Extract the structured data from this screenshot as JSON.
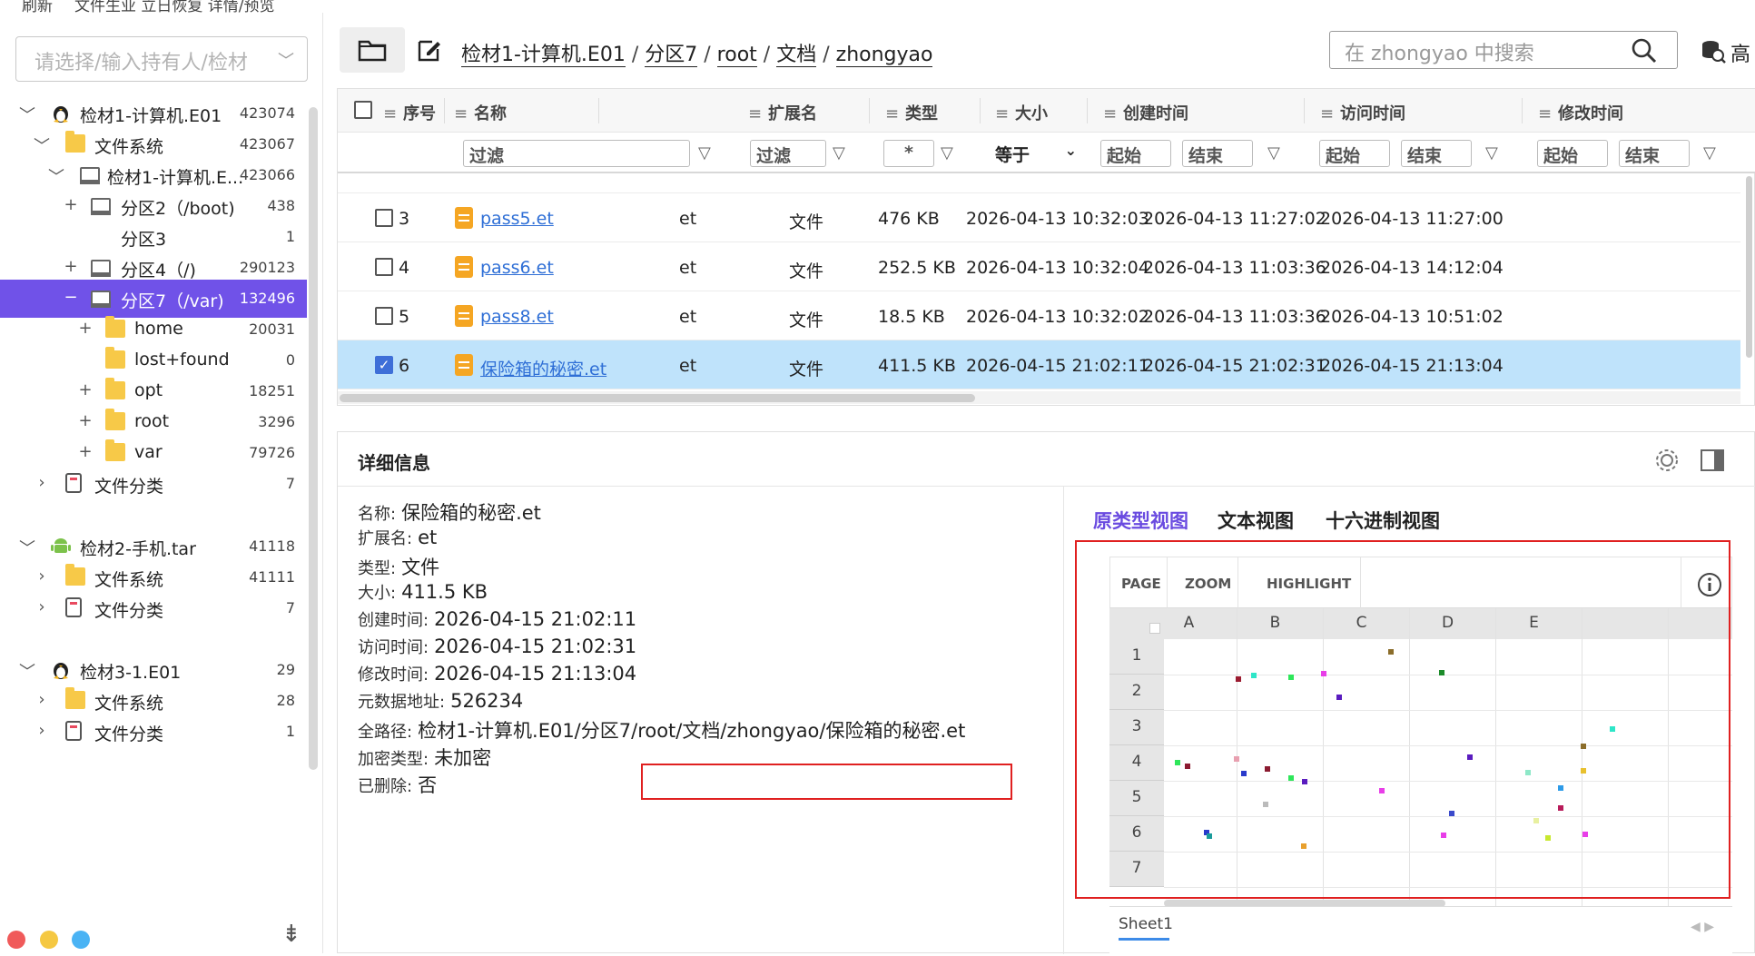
{
  "top": {
    "left_text": "刷新",
    "right_text": "文件生业 立日恢复 详情/预览"
  },
  "owner_select": {
    "placeholder": "请选择/输入持有人/检材"
  },
  "tree": [
    {
      "label": "检材1-计算机.E01",
      "count": "423074"
    },
    {
      "label": "文件系统",
      "count": "423067"
    },
    {
      "label": "检材1-计算机.E...",
      "count": "423066"
    },
    {
      "label": "分区2（/boot)",
      "count": "438"
    },
    {
      "label": "分区3",
      "count": "1"
    },
    {
      "label": "分区4（/)",
      "count": "290123"
    },
    {
      "label": "分区7（/var)",
      "count": "132496"
    },
    {
      "label": "home",
      "count": "20031"
    },
    {
      "label": "lost+found",
      "count": "0"
    },
    {
      "label": "opt",
      "count": "18251"
    },
    {
      "label": "root",
      "count": "3296"
    },
    {
      "label": "var",
      "count": "79726"
    },
    {
      "label": "文件分类",
      "count": "7"
    },
    {
      "label": "检材2-手机.tar",
      "count": "41118"
    },
    {
      "label": "文件系统",
      "count": "41111"
    },
    {
      "label": "文件分类",
      "count": "7"
    },
    {
      "label": "检材3-1.E01",
      "count": "29"
    },
    {
      "label": "文件系统",
      "count": "28"
    },
    {
      "label": "文件分类",
      "count": "1"
    }
  ],
  "breadcrumb": [
    "检材1-计算机.E01",
    "分区7",
    "root",
    "文档",
    "zhongyao"
  ],
  "search": {
    "placeholder": "在 zhongyao 中搜索"
  },
  "advanced_label": "高",
  "grid": {
    "headers": [
      "序号",
      "名称",
      "扩展名",
      "类型",
      "大小",
      "创建时间",
      "访问时间",
      "修改时间"
    ],
    "filters": {
      "text": "过滤",
      "ext": "过滤",
      "type": "*",
      "size": "等于",
      "start": "起始",
      "end": "结束"
    },
    "rows": [
      {
        "no": "3",
        "name": "pass5.et",
        "ext": "et",
        "type": "文件",
        "size": "476 KB",
        "created": "2026-04-13 10:32:03",
        "accessed": "2026-04-13 11:27:02",
        "modified": "2026-04-13 11:27:00"
      },
      {
        "no": "4",
        "name": "pass6.et",
        "ext": "et",
        "type": "文件",
        "size": "252.5 KB",
        "created": "2026-04-13 10:32:04",
        "accessed": "2026-04-13 11:03:36",
        "modified": "2026-04-13 14:12:04"
      },
      {
        "no": "5",
        "name": "pass8.et",
        "ext": "et",
        "type": "文件",
        "size": "18.5 KB",
        "created": "2026-04-13 10:32:02",
        "accessed": "2026-04-13 11:03:36",
        "modified": "2026-04-13 10:51:02"
      },
      {
        "no": "6",
        "name": "保险箱的秘密.et",
        "ext": "et",
        "type": "文件",
        "size": "411.5 KB",
        "created": "2026-04-15 21:02:11",
        "accessed": "2026-04-15 21:02:31",
        "modified": "2026-04-15 21:13:04"
      }
    ]
  },
  "details": {
    "title": "详细信息",
    "props": [
      {
        "label": "名称:",
        "value": "保险箱的秘密.et"
      },
      {
        "label": "扩展名:",
        "value": "et"
      },
      {
        "label": "类型:",
        "value": "文件"
      },
      {
        "label": "大小:",
        "value": "411.5 KB"
      },
      {
        "label": "创建时间:",
        "value": "2026-04-15 21:02:11"
      },
      {
        "label": "访问时间:",
        "value": "2026-04-15 21:02:31"
      },
      {
        "label": "修改时间:",
        "value": "2026-04-15 21:13:04"
      },
      {
        "label": "元数据地址:",
        "value": "526234"
      },
      {
        "label": "全路径:",
        "value": "检材1-计算机.E01/分区7/root/文档/zhongyao/保险箱的秘密.et"
      },
      {
        "label": "加密类型:",
        "value": "未加密"
      },
      {
        "label": "已删除:",
        "value": "否"
      }
    ],
    "view_tabs": [
      "原类型视图",
      "文本视图",
      "十六进制视图"
    ]
  },
  "sheet": {
    "toolbar": [
      "PAGE",
      "ZOOM",
      "HIGHLIGHT"
    ],
    "columns": [
      "A",
      "B",
      "C",
      "D",
      "E"
    ],
    "rows": [
      "1",
      "2",
      "3",
      "4",
      "5",
      "6",
      "7"
    ],
    "tab": "Sheet1"
  },
  "colors": {
    "accent": "#7052e8",
    "selected_row": "#bfe3fb",
    "link": "#2f6fd6",
    "highlight_box": "#e02020"
  }
}
